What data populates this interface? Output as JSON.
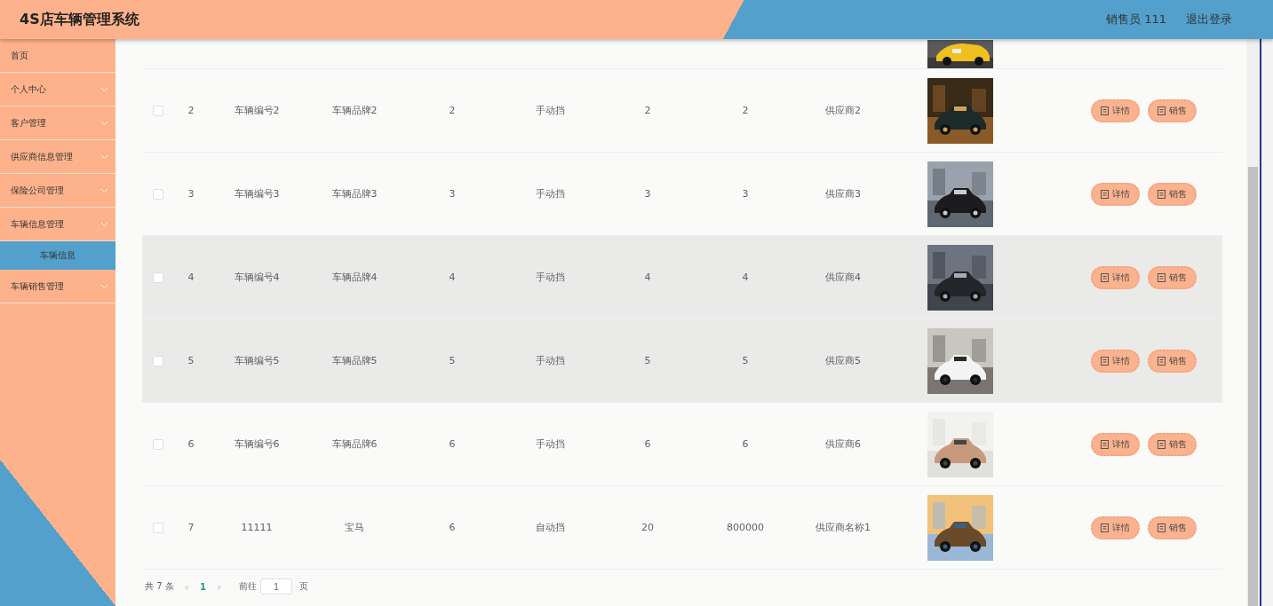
{
  "header": {
    "title": "4S店车辆管理系统",
    "user": "销售员 111",
    "logout": "退出登录"
  },
  "sidebar": {
    "items": [
      {
        "label": "首页",
        "expandable": false
      },
      {
        "label": "个人中心",
        "expandable": true
      },
      {
        "label": "客户管理",
        "expandable": true
      },
      {
        "label": "供应商信息管理",
        "expandable": true
      },
      {
        "label": "保险公司管理",
        "expandable": true
      },
      {
        "label": "车辆信息管理",
        "expandable": true,
        "expanded": true,
        "children": [
          {
            "label": "车辆信息",
            "selected": true
          }
        ]
      },
      {
        "label": "车辆销售管理",
        "expandable": true
      }
    ]
  },
  "table": {
    "rows": [
      {
        "checked": false,
        "highlighted": false,
        "cells": [
          "2",
          "车辆编号2",
          "车辆品牌2",
          "2",
          "手动挡",
          "2",
          "2",
          "供应商2"
        ],
        "actions": [
          "详情",
          "销售"
        ]
      },
      {
        "checked": false,
        "highlighted": false,
        "cells": [
          "3",
          "车辆编号3",
          "车辆品牌3",
          "3",
          "手动挡",
          "3",
          "3",
          "供应商3"
        ],
        "actions": [
          "详情",
          "销售"
        ]
      },
      {
        "checked": false,
        "highlighted": true,
        "cells": [
          "4",
          "车辆编号4",
          "车辆品牌4",
          "4",
          "手动挡",
          "4",
          "4",
          "供应商4"
        ],
        "actions": [
          "详情",
          "销售"
        ]
      },
      {
        "checked": false,
        "highlighted": true,
        "cells": [
          "5",
          "车辆编号5",
          "车辆品牌5",
          "5",
          "手动挡",
          "5",
          "5",
          "供应商5"
        ],
        "actions": [
          "详情",
          "销售"
        ]
      },
      {
        "checked": false,
        "highlighted": false,
        "cells": [
          "6",
          "车辆编号6",
          "车辆品牌6",
          "6",
          "手动挡",
          "6",
          "6",
          "供应商6"
        ],
        "actions": [
          "详情",
          "销售"
        ]
      },
      {
        "checked": false,
        "highlighted": false,
        "cells": [
          "7",
          "11111",
          "宝马",
          "6",
          "自动挡",
          "20",
          "800000",
          "供应商名称1"
        ],
        "actions": [
          "详情",
          "销售"
        ]
      }
    ]
  },
  "pagination": {
    "total": "共 7 条",
    "prev": "‹",
    "pages": [
      {
        "label": "1",
        "selected": true
      }
    ],
    "next": "›",
    "goto_label": "前往",
    "goto_value": "1",
    "goto_suffix": "页"
  }
}
